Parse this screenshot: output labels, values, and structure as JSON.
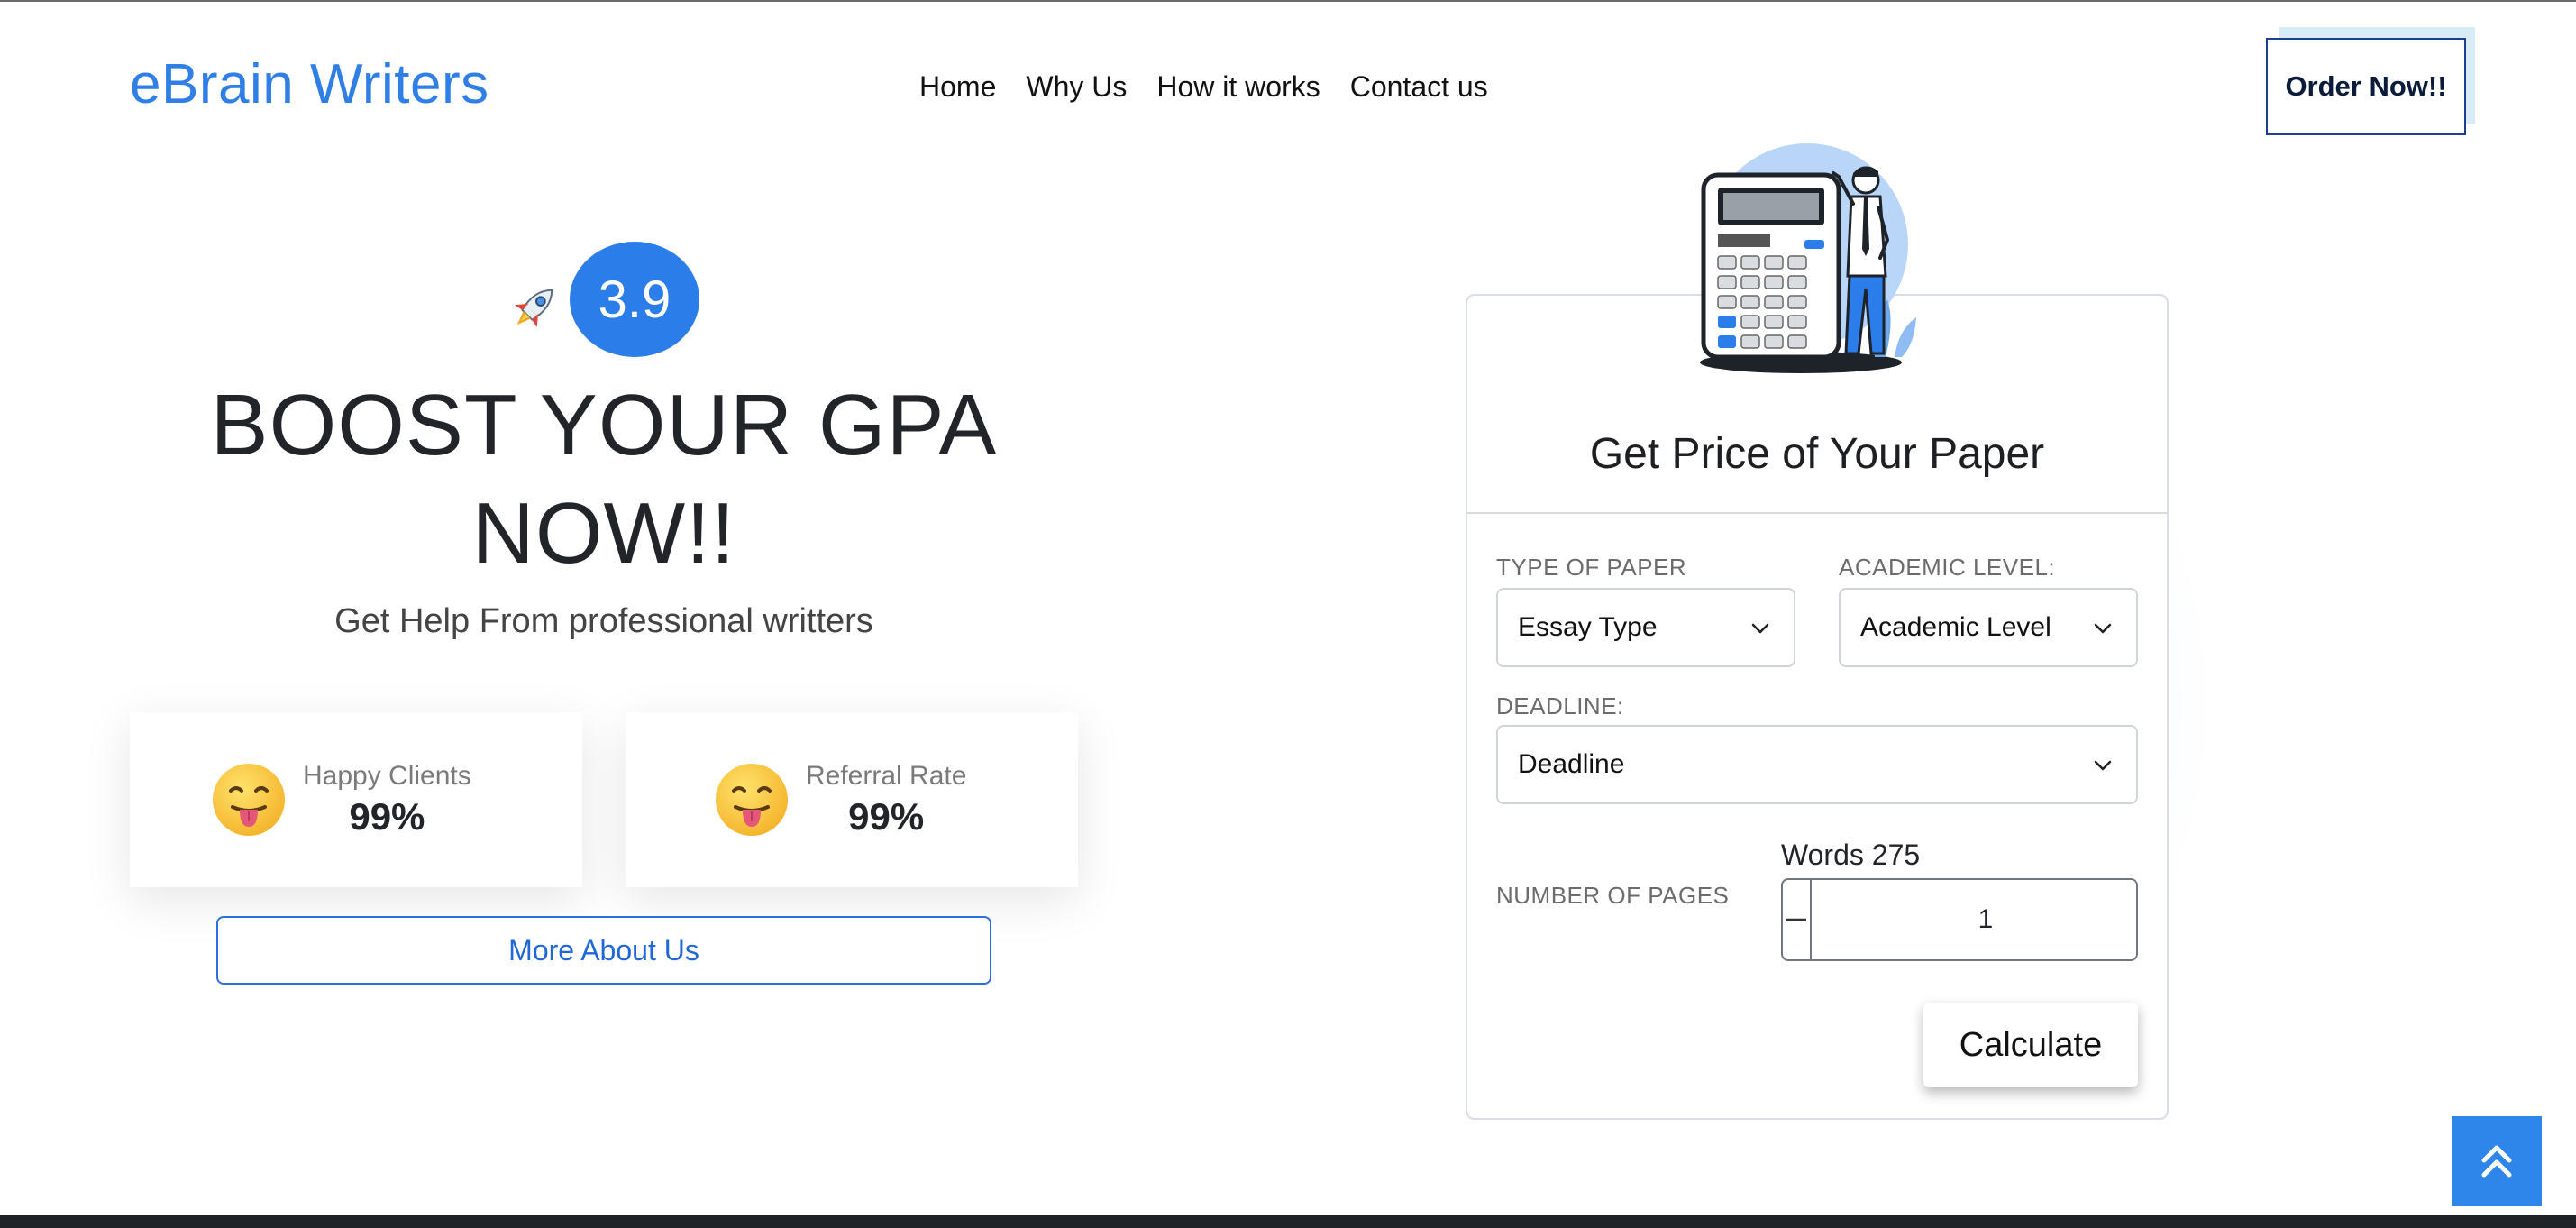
{
  "header": {
    "logo": "eBrain Writers",
    "nav": [
      "Home",
      "Why Us",
      "How it works",
      "Contact us"
    ],
    "order_label": "Order Now!!"
  },
  "hero": {
    "rating": "3.9",
    "title_line1": "BOOST YOUR GPA",
    "title_line2": "NOW!!",
    "subtitle": "Get Help From professional writters",
    "stats": [
      {
        "label": "Happy Clients",
        "value": "99%"
      },
      {
        "label": "Referral Rate",
        "value": "99%"
      }
    ],
    "more_label": "More About Us",
    "icons": {
      "rocket": "rocket-icon",
      "emoji": "tongue-out-emoji-icon"
    }
  },
  "calculator": {
    "title": "Get Price of Your Paper",
    "type_label": "TYPE OF PAPER",
    "type_value": "Essay Type",
    "level_label": "ACADEMIC LEVEL:",
    "level_value": "Academic Level",
    "deadline_label": "DEADLINE:",
    "deadline_value": "Deadline",
    "pages_label": "NUMBER OF PAGES",
    "words_text": "Words 275",
    "pages_value": "1",
    "calculate_label": "Calculate",
    "icons": {
      "minus": "minus-icon",
      "plus": "plus-icon",
      "chevron": "chevron-down-icon",
      "illustration": "calculator-illustration"
    }
  },
  "scroll_top": {
    "icon": "double-chevron-up-icon"
  },
  "colors": {
    "brand": "#2f7fe6",
    "rating_badge": "#2b7de9",
    "order_highlight": "#d7ecf7",
    "scroll_button": "#2e86ea"
  }
}
